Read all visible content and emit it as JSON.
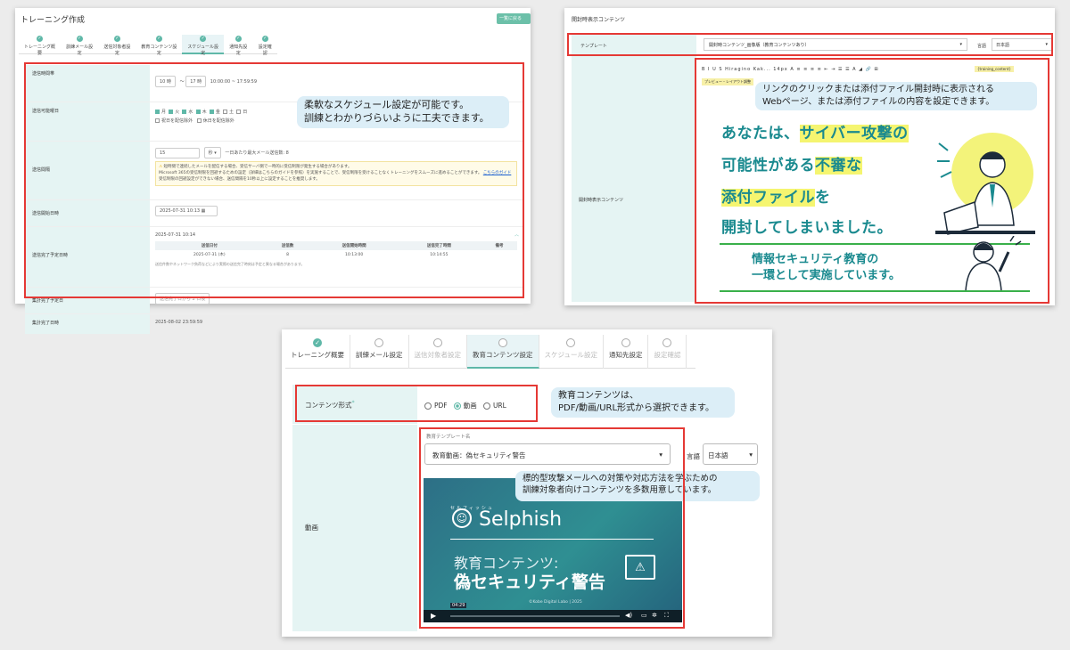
{
  "panel1": {
    "title": "トレーニング作成",
    "top_button": "一覧に戻る",
    "tabs": [
      {
        "label": "トレーニング概要"
      },
      {
        "label": "訓練メール設定"
      },
      {
        "label": "送信対象者設定"
      },
      {
        "label": "教育コンテンツ設定"
      },
      {
        "label": "スケジュール設定"
      },
      {
        "label": "通知先設定"
      },
      {
        "label": "設定確認"
      }
    ],
    "rows": {
      "send_time": {
        "label": "送信時間帯",
        "from": "10",
        "from_unit": "時",
        "to": "17",
        "to_unit": "時",
        "range": "10:00:00 ~ 17:59:59"
      },
      "weekdays": {
        "label": "送信可能曜日",
        "days": [
          "月",
          "火",
          "水",
          "木",
          "金",
          "土",
          "日"
        ],
        "opt1": "祝日を配信除外",
        "opt2": "休日を配信除外"
      },
      "interval": {
        "label": "送信間隔",
        "value": "15",
        "unit": "秒",
        "note": "一日あたり最大メール送信数: 8",
        "warn1": "短時間で連続したメールを配信する場合、受信サーバ側で一時的に受信制限が発生する場合があります。",
        "warn2": "Microsoft 365の受信制限を回避するための設定（詳細はこちらのガイドを参照）を実施することで、受信制限を受けることなくトレーニングをスムーズに進めることができます。",
        "warn_link": "こちらのガイド",
        "warn3": "受信制限の回避設定ができない場合、送信間隔を10秒以上に設定することを推奨します。"
      },
      "start": {
        "label": "送信開始日時",
        "value": "2025-07-31 10:13"
      },
      "finish_estimate": {
        "label": "送信完了予定日時",
        "date": "2025-07-31 10:14",
        "headers": [
          "送信日付",
          "送信数",
          "送信開始時間",
          "送信完了時間",
          "備考"
        ],
        "row": [
          "2025-07-31 (木)",
          "8",
          "10:13:00",
          "10:14:55",
          ""
        ],
        "footnote": "送信件数やネットワーク負荷などにより実際の送信完了時刻は予定と異なる場合があります。"
      },
      "collect_estimate": {
        "label": "集計完了予定日",
        "value": "送信完了日から 2",
        "unit": "日後"
      },
      "collect_finish": {
        "label": "集計完了日時",
        "value": "2025-08-02 23:59:59"
      }
    },
    "callout": {
      "line1": "柔軟なスケジュール設定が可能です。",
      "line2": "訓練とわかりづらいように工夫できます。"
    }
  },
  "panel2": {
    "title": "開封時表示コンテンツ",
    "template_label": "テンプレート",
    "template_value": "開封時コンテンツ_画像版（教育コンテンツあり）",
    "lang_label": "言語",
    "lang_value": "日本語",
    "content_label": "開封時表示コンテンツ",
    "toolbar": "B I U S  Hiragino Kak...  14px  A  ≡ ≡ ≡ ≡  ⇤ ⇥  ☰ ☰  A ◢  🔗 ⊞",
    "tag_training": "{training_content}",
    "tag_preview": "プレビュー・レイアウト調整",
    "callout": {
      "line1": "リンクのクリックまたは添付ファイル開封時に表示される",
      "line2": "Webページ、または添付ファイルの内容を設定できます。"
    },
    "content": {
      "l1a": "あなたは、",
      "l1b": "サイバー攻撃の",
      "l2a": "可能性がある",
      "l2b": "不審な",
      "l3a": "添付ファイル",
      "l3b": "を",
      "l4": "開封してしまいました。",
      "f1": "情報セキュリティ教育の",
      "f2": "一環として実施しています。"
    }
  },
  "panel3": {
    "tabs": [
      {
        "label": "トレーニング概要",
        "state": "done"
      },
      {
        "label": "訓練メール設定",
        "state": "todo"
      },
      {
        "label": "送信対象者設定",
        "state": "disabled"
      },
      {
        "label": "教育コンテンツ設定",
        "state": "active"
      },
      {
        "label": "スケジュール設定",
        "state": "disabled"
      },
      {
        "label": "通知先設定",
        "state": "todo"
      },
      {
        "label": "設定確認",
        "state": "disabled"
      }
    ],
    "content_format_label": "コンテンツ形式",
    "options": [
      "PDF",
      "動画",
      "URL"
    ],
    "selected_option": "動画",
    "video_label": "動画",
    "template_label": "教育テンプレート名",
    "template_value": "教育動画：偽セキュリティ警告",
    "lang_label": "言語",
    "lang_value": "日本語",
    "callout1": {
      "line1": "教育コンテンツは、",
      "line2": "PDF/動画/URL形式から選択できます。"
    },
    "callout2": {
      "line1": "標的型攻撃メールへの対策や対応方法を学ぶための",
      "line2": "訓練対象者向けコンテンツを多数用意しています。"
    },
    "video": {
      "brand_kana": "セルフィッシュ",
      "brand": "Selphish",
      "t1": "教育コンテンツ:",
      "t2": "偽セキュリティ警告",
      "copyright": "©Kobe Digital Labo | 2025",
      "time": "04:29"
    }
  }
}
